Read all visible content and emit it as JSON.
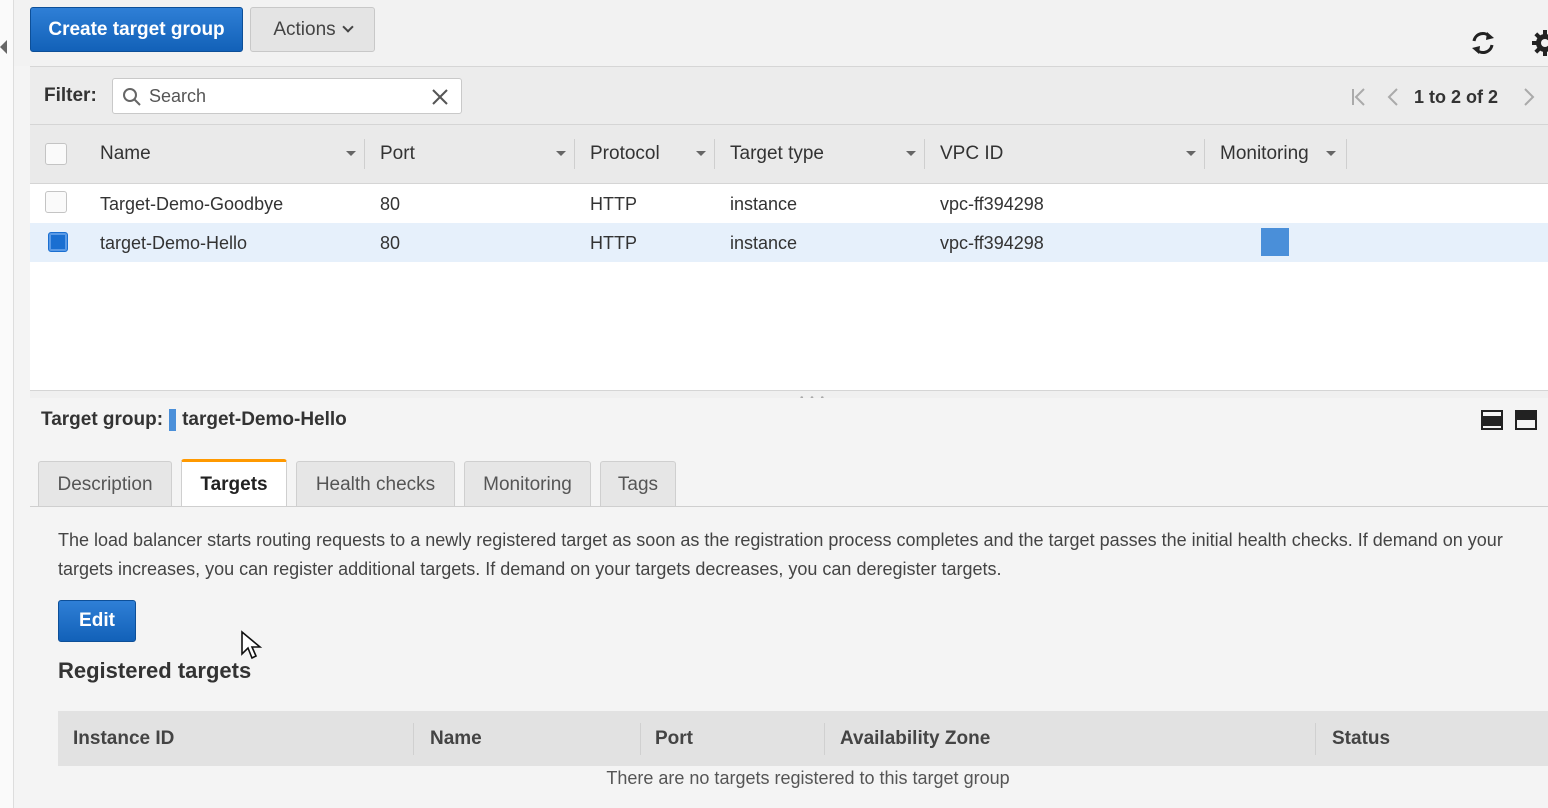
{
  "toolbar": {
    "create_label": "Create target group",
    "actions_label": "Actions"
  },
  "filter": {
    "label": "Filter:",
    "placeholder": "Search",
    "pagination": "1 to 2 of 2"
  },
  "grid": {
    "columns": [
      "Name",
      "Port",
      "Protocol",
      "Target type",
      "VPC ID",
      "Monitoring"
    ],
    "rows": [
      {
        "name": "Target-Demo-Goodbye",
        "port": "80",
        "protocol": "HTTP",
        "target_type": "instance",
        "vpc_id": "vpc-ff394298",
        "selected": false
      },
      {
        "name": "target-Demo-Hello",
        "port": "80",
        "protocol": "HTTP",
        "target_type": "instance",
        "vpc_id": "vpc-ff394298",
        "selected": true
      }
    ]
  },
  "detail": {
    "label": "Target group:",
    "name": "target-Demo-Hello",
    "tabs": [
      "Description",
      "Targets",
      "Health checks",
      "Monitoring",
      "Tags"
    ],
    "active_tab": "Targets",
    "description": "The load balancer starts routing requests to a newly registered target as soon as the registration process completes and the target passes the initial health checks. If demand on your targets increases, you can register additional targets. If demand on your targets decreases, you can deregister targets.",
    "edit_label": "Edit",
    "registered_title": "Registered targets",
    "registered_columns": [
      "Instance ID",
      "Name",
      "Port",
      "Availability Zone",
      "Status"
    ],
    "empty_message": "There are no targets registered to this target group"
  },
  "colors": {
    "primary": "#1a6fd1",
    "tab_accent": "#ff9900",
    "selected_row": "#e6f0fb"
  }
}
